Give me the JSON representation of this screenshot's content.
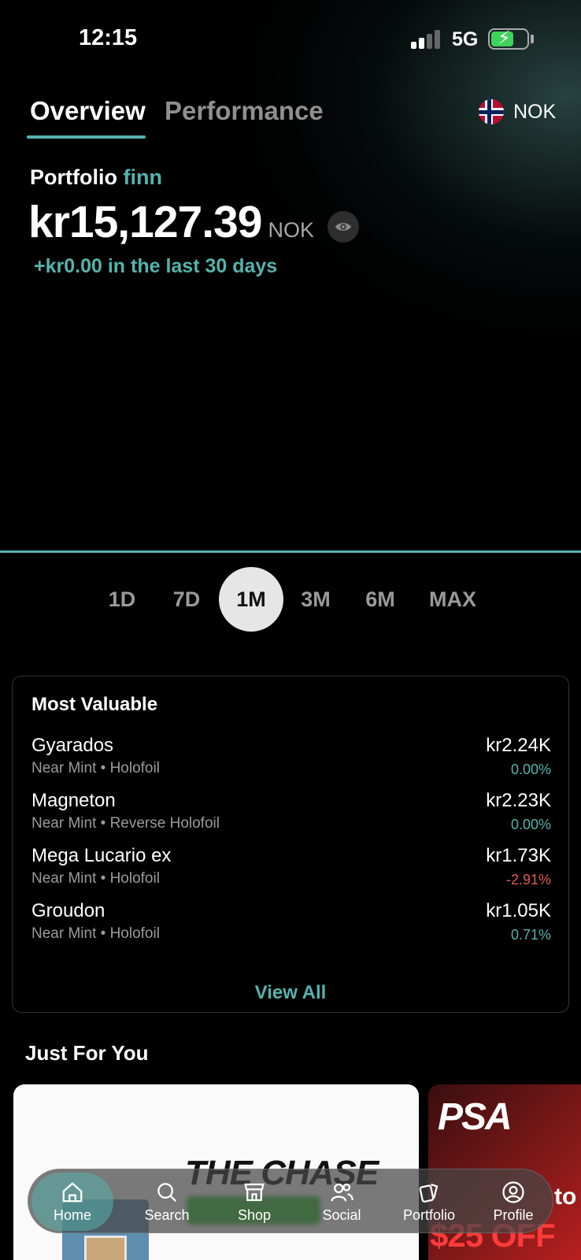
{
  "status_bar": {
    "time": "12:15",
    "network": "5G"
  },
  "tabs": {
    "overview": "Overview",
    "performance": "Performance"
  },
  "currency": {
    "code": "NOK",
    "flag_icon": "norway-flag-icon"
  },
  "portfolio": {
    "label": "Portfolio",
    "name": "finn",
    "value": "kr15,127.39",
    "unit": "NOK",
    "change_text": "+kr0.00 in the last 30 days"
  },
  "range_selector": {
    "options": [
      "1D",
      "7D",
      "1M",
      "3M",
      "6M",
      "MAX"
    ],
    "selected": "1M"
  },
  "most_valuable": {
    "title": "Most Valuable",
    "items": [
      {
        "name": "Gyarados",
        "detail": "Near Mint • Holofoil",
        "price": "kr2.24K",
        "change": "0.00%",
        "direction": "pos"
      },
      {
        "name": "Magneton",
        "detail": "Near Mint • Reverse Holofoil",
        "price": "kr2.23K",
        "change": "0.00%",
        "direction": "pos"
      },
      {
        "name": "Mega Lucario ex",
        "detail": "Near Mint • Holofoil",
        "price": "kr1.73K",
        "change": "-2.91%",
        "direction": "neg"
      },
      {
        "name": "Groudon",
        "detail": "Near Mint • Holofoil",
        "price": "kr1.05K",
        "change": "0.71%",
        "direction": "pos"
      }
    ],
    "view_all": "View All"
  },
  "just_for_you": {
    "title": "Just For You",
    "promo_headline": "THE CHASE",
    "psa_logo": "PSA",
    "psa_to": "to",
    "psa_offer": "$25 OFF"
  },
  "tab_bar": {
    "items": [
      {
        "label": "Home",
        "icon": "home-icon"
      },
      {
        "label": "Search",
        "icon": "search-icon"
      },
      {
        "label": "Shop",
        "icon": "shop-icon"
      },
      {
        "label": "Social",
        "icon": "social-icon"
      },
      {
        "label": "Portfolio",
        "icon": "cards-icon"
      },
      {
        "label": "Profile",
        "icon": "profile-icon"
      }
    ],
    "active": "Home"
  },
  "colors": {
    "accent": "#55b3ad",
    "negative": "#e05a4e",
    "background": "#000000"
  }
}
